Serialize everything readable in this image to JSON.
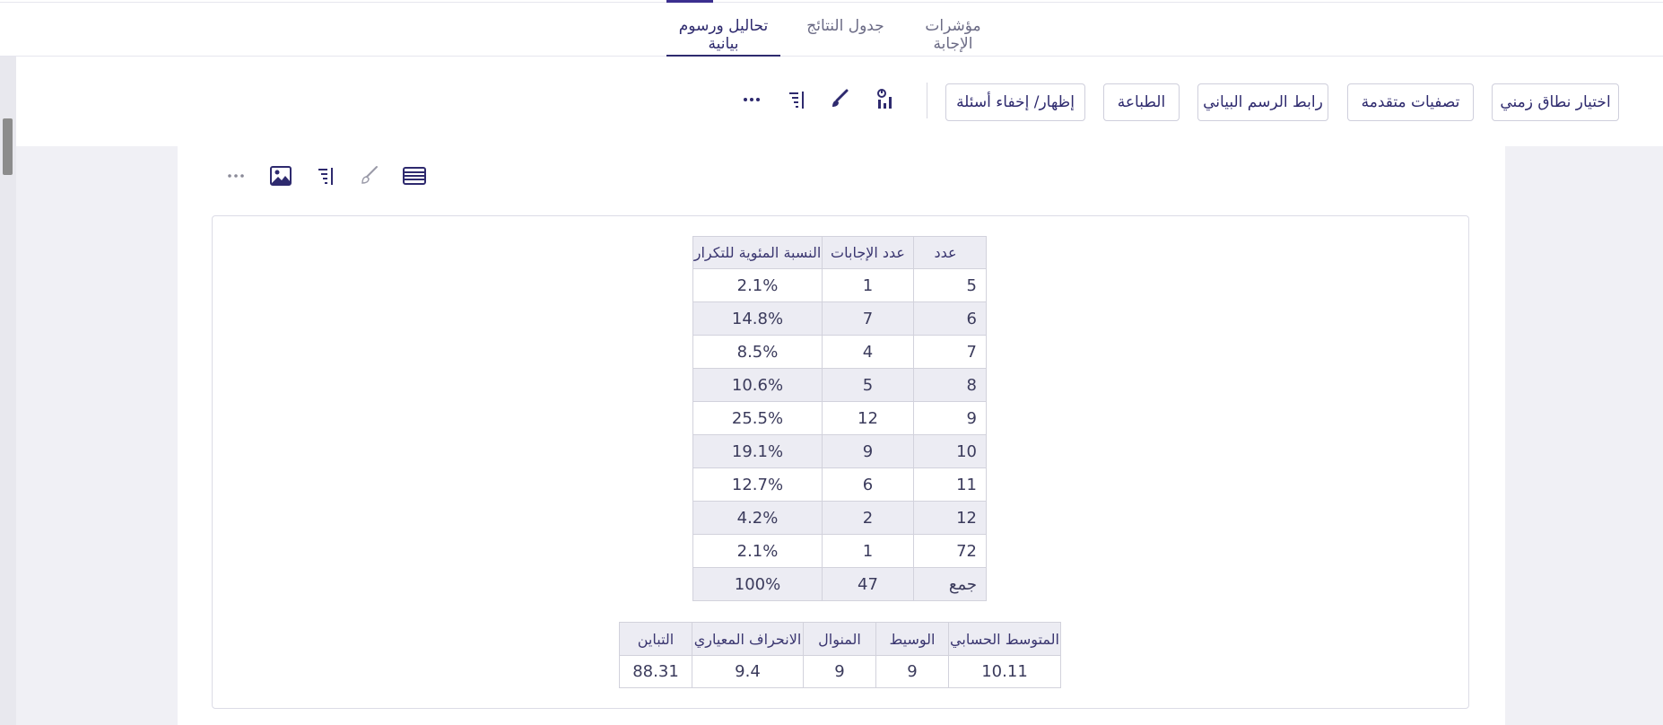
{
  "tabs": {
    "analysis": "تحاليل ورسوم بيانية",
    "results": "جدول النتائج",
    "indicators": "مؤشرات الإجابة"
  },
  "toolbar": {
    "time_range": "اختيار نطاق زمني",
    "advanced_filters": "تصفيات متقدمة",
    "chart_link": "رابط الرسم البياني",
    "print": "الطباعة",
    "show_hide": "إظهار/ إخفاء أسئلة",
    "icons": [
      "chart-settings-icon",
      "brush-icon",
      "sort-lines-icon",
      "more-icon"
    ]
  },
  "section_icons": [
    "table-view-icon",
    "brush-icon",
    "sort-lines-icon",
    "image-icon",
    "more-icon"
  ],
  "frequency_table": {
    "headers": {
      "number": "عدد",
      "count": "عدد الإجابات",
      "percent": "النسبة المئوية للتكرار"
    },
    "rows": [
      {
        "number": "5",
        "count": "1",
        "percent": "2.1%"
      },
      {
        "number": "6",
        "count": "7",
        "percent": "14.8%"
      },
      {
        "number": "7",
        "count": "4",
        "percent": "8.5%"
      },
      {
        "number": "8",
        "count": "5",
        "percent": "10.6%"
      },
      {
        "number": "9",
        "count": "12",
        "percent": "25.5%"
      },
      {
        "number": "10",
        "count": "9",
        "percent": "19.1%"
      },
      {
        "number": "11",
        "count": "6",
        "percent": "12.7%"
      },
      {
        "number": "12",
        "count": "2",
        "percent": "4.2%"
      },
      {
        "number": "72",
        "count": "1",
        "percent": "2.1%"
      },
      {
        "number": "جمع",
        "count": "47",
        "percent": "100%"
      }
    ]
  },
  "stats_table": {
    "headers": {
      "mean": "المتوسط الحسابي",
      "median": "الوسيط",
      "mode": "المنوال",
      "std": "الانحراف المعياري",
      "variance": "التباين"
    },
    "values": {
      "mean": "10.11",
      "median": "9",
      "mode": "9",
      "std": "9.4",
      "variance": "88.31"
    }
  },
  "colors": {
    "accent": "#2e2a6e",
    "row_alt": "#ececf3",
    "border": "#d2d2dc"
  }
}
